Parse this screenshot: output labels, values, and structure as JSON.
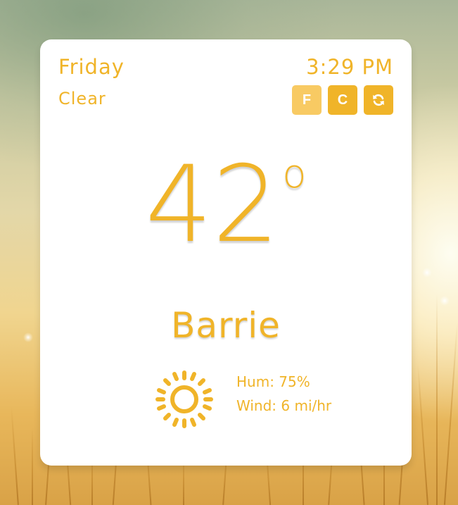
{
  "weather": {
    "day": "Friday",
    "condition": "Clear",
    "time": "3:29 PM",
    "temperature": "42",
    "degree_symbol": "o",
    "city": "Barrie",
    "humidity_label": "Hum:",
    "humidity_value": "75%",
    "wind_label": "Wind:",
    "wind_value": "6 mi/hr",
    "condition_icon": "sun-icon"
  },
  "controls": {
    "fahrenheit_label": "F",
    "celsius_label": "C",
    "selected_unit": "F",
    "refresh_icon": "refresh-icon"
  },
  "colors": {
    "accent": "#f0b429",
    "accent_light": "#f8ca63",
    "card_background": "#ffffff"
  }
}
